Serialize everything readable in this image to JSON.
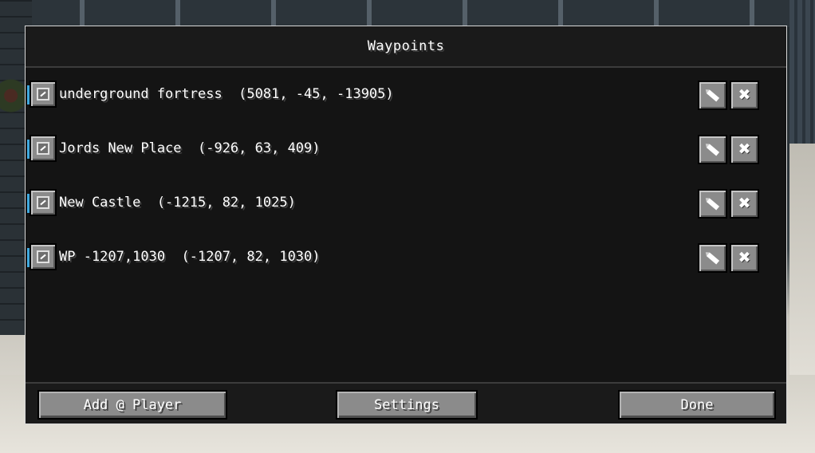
{
  "screen": {
    "title": "Waypoints"
  },
  "waypoints": [
    {
      "name": "underground fortress",
      "coords": "(5081, -45, -13905)",
      "enabled": true
    },
    {
      "name": "Jords New Place",
      "coords": "(-926, 63, 409)",
      "enabled": true
    },
    {
      "name": "New Castle",
      "coords": "(-1215, 82, 1025)",
      "enabled": true
    },
    {
      "name": "WP -1207,1030",
      "coords": "(-1207, 82, 1030)",
      "enabled": true
    }
  ],
  "row_labels": [
    "underground fortress  (5081, -45, -13905)",
    "Jords New Place  (-926, 63, 409)",
    "New Castle  (-1215, 82, 1025)",
    "WP -1207,1030  (-1207, 82, 1030)"
  ],
  "row_icons": {
    "toggle": "checkbox-checked-icon",
    "edit": "pencil-icon",
    "delete": "close-icon"
  },
  "footer": {
    "add_label": "Add @ Player",
    "settings_label": "Settings",
    "done_label": "Done"
  },
  "colors": {
    "accent_marker": "#3fa9df",
    "button_face": "#8b8b8b",
    "text": "#ffffff"
  }
}
